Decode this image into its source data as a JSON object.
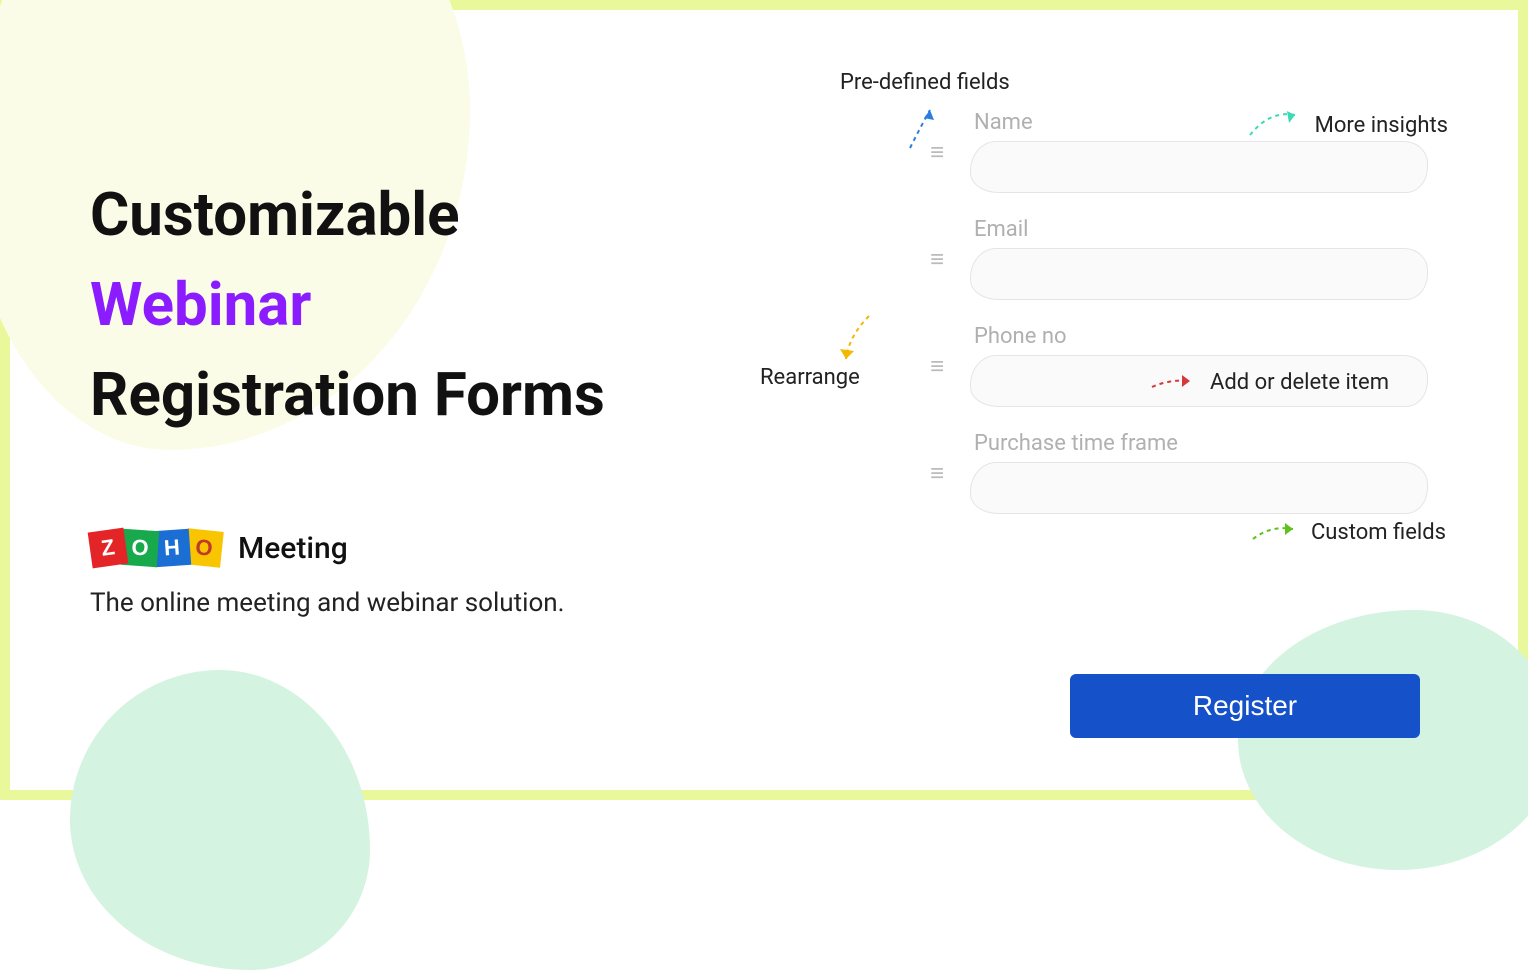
{
  "headline": {
    "line1": "Customizable",
    "line2_accent": "Webinar",
    "line3": "Registration Forms"
  },
  "brand": {
    "logo_letters": [
      "Z",
      "O",
      "H",
      "O"
    ],
    "product_name": "Meeting",
    "tagline": "The online meeting and webinar solution."
  },
  "callouts": {
    "predefined": "Pre-defined fields",
    "insights": "More insights",
    "rearrange": "Rearrange",
    "addordelete": "Add or delete item",
    "custom": "Custom fields"
  },
  "form": {
    "fields": [
      {
        "label": "Name"
      },
      {
        "label": "Email"
      },
      {
        "label": "Phone no"
      },
      {
        "label": "Purchase time frame"
      }
    ],
    "register_label": "Register"
  },
  "colors": {
    "accent_purple": "#8a1cff",
    "register_blue": "#1552c9",
    "arrow_blue": "#2b7ee0",
    "arrow_teal": "#3dd9b5",
    "arrow_yellow": "#f2b900",
    "arrow_red": "#d43a3a",
    "arrow_green": "#5fc21e"
  }
}
